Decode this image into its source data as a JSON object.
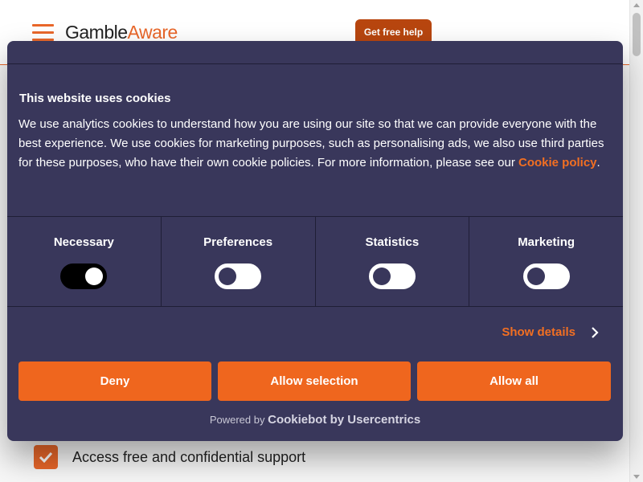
{
  "header": {
    "logo_part1": "Gamble",
    "logo_part2": "Aware",
    "help_button": "Get free help"
  },
  "background": {
    "support_text": "Access free and confidential support"
  },
  "dialog": {
    "title": "This website uses cookies",
    "body_text": "We use analytics cookies to understand how you are using our site so that we can provide everyone with the best experience. We use cookies for marketing purposes, such as personalising ads, we also use third parties for these purposes, who have their own cookie policies. For more information, please see our ",
    "policy_link": "Cookie policy",
    "body_end": ".",
    "categories": [
      {
        "label": "Necessary",
        "enabled": true
      },
      {
        "label": "Preferences",
        "enabled": false
      },
      {
        "label": "Statistics",
        "enabled": false
      },
      {
        "label": "Marketing",
        "enabled": false
      }
    ],
    "show_details": "Show details",
    "buttons": {
      "deny": "Deny",
      "allow_selection": "Allow selection",
      "allow_all": "Allow all"
    },
    "powered_prefix": "Powered by",
    "powered_brand": "Cookiebot by Usercentrics"
  },
  "colors": {
    "accent": "#ef661e",
    "dialog_bg": "#39375b"
  }
}
